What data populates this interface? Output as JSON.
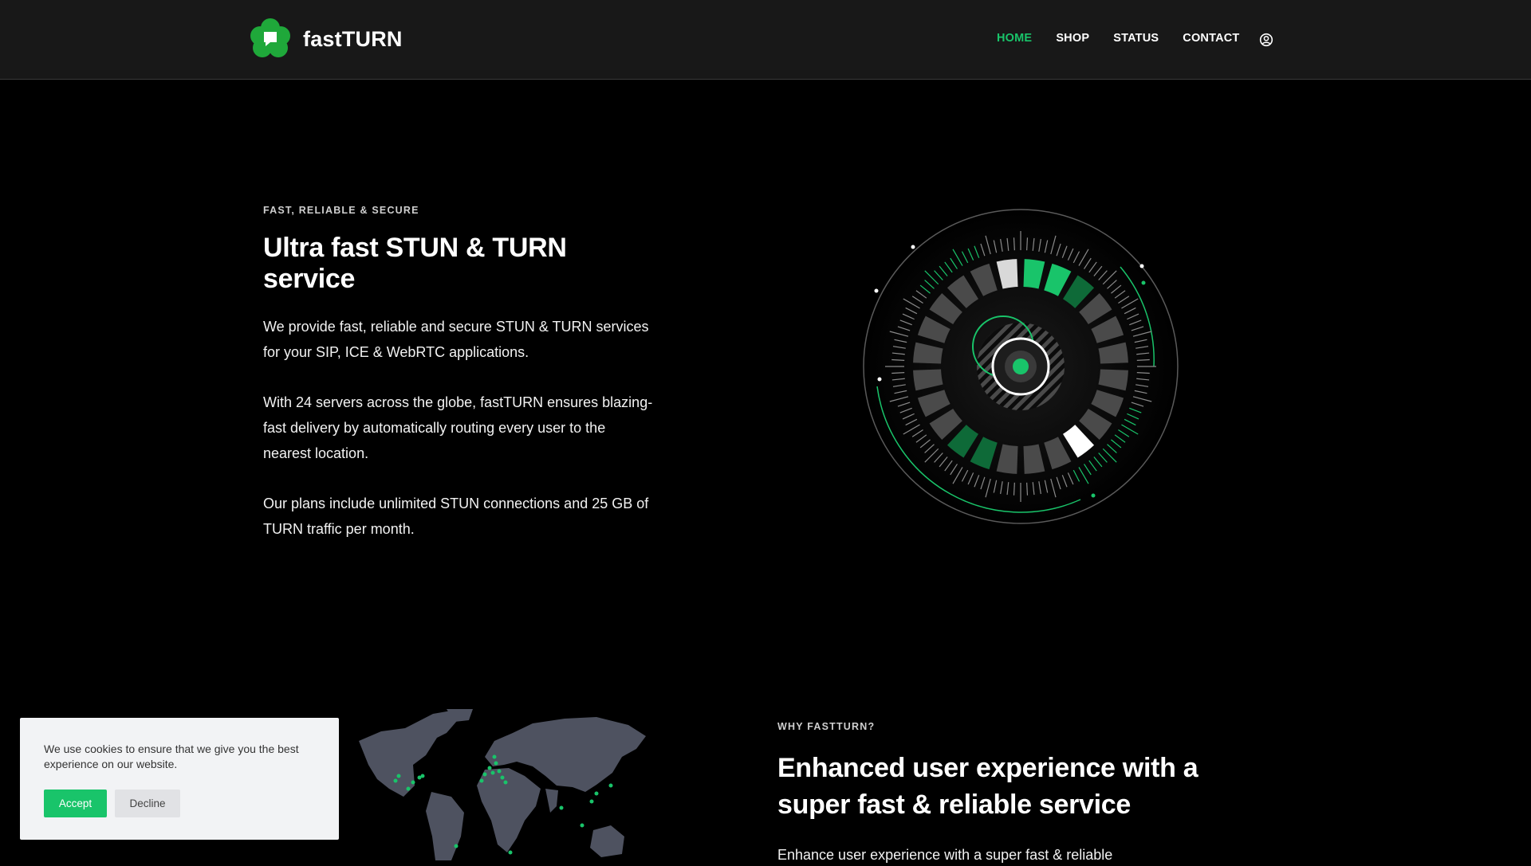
{
  "header": {
    "brand": "fastTURN",
    "nav": [
      {
        "label": "HOME",
        "active": true
      },
      {
        "label": "SHOP",
        "active": false
      },
      {
        "label": "STATUS",
        "active": false
      },
      {
        "label": "CONTACT",
        "active": false
      }
    ],
    "user_icon": "user-circle-icon"
  },
  "hero": {
    "eyebrow": "FAST, RELIABLE & SECURE",
    "title": "Ultra fast STUN & TURN service",
    "paragraphs": [
      "We provide fast, reliable and secure STUN & TURN services for your SIP, ICE & WebRTC applications.",
      "With 24 servers across the globe, fastTURN ensures blazing-fast delivery by automatically routing every user to the nearest location.",
      "Our plans include unlimited STUN connections and 25 GB of TURN traffic per month."
    ]
  },
  "why": {
    "eyebrow": "WHY FASTTURN?",
    "title": "Enhanced user experience with a super fast & reliable service",
    "text": "Enhance user experience with a super fast & reliable"
  },
  "cookie": {
    "message": "We use cookies to ensure that we give you the best experience on our website.",
    "accept": "Accept",
    "decline": "Decline"
  },
  "colors": {
    "accent": "#19c46a",
    "header_bg": "#181818",
    "page_bg": "#000000"
  }
}
